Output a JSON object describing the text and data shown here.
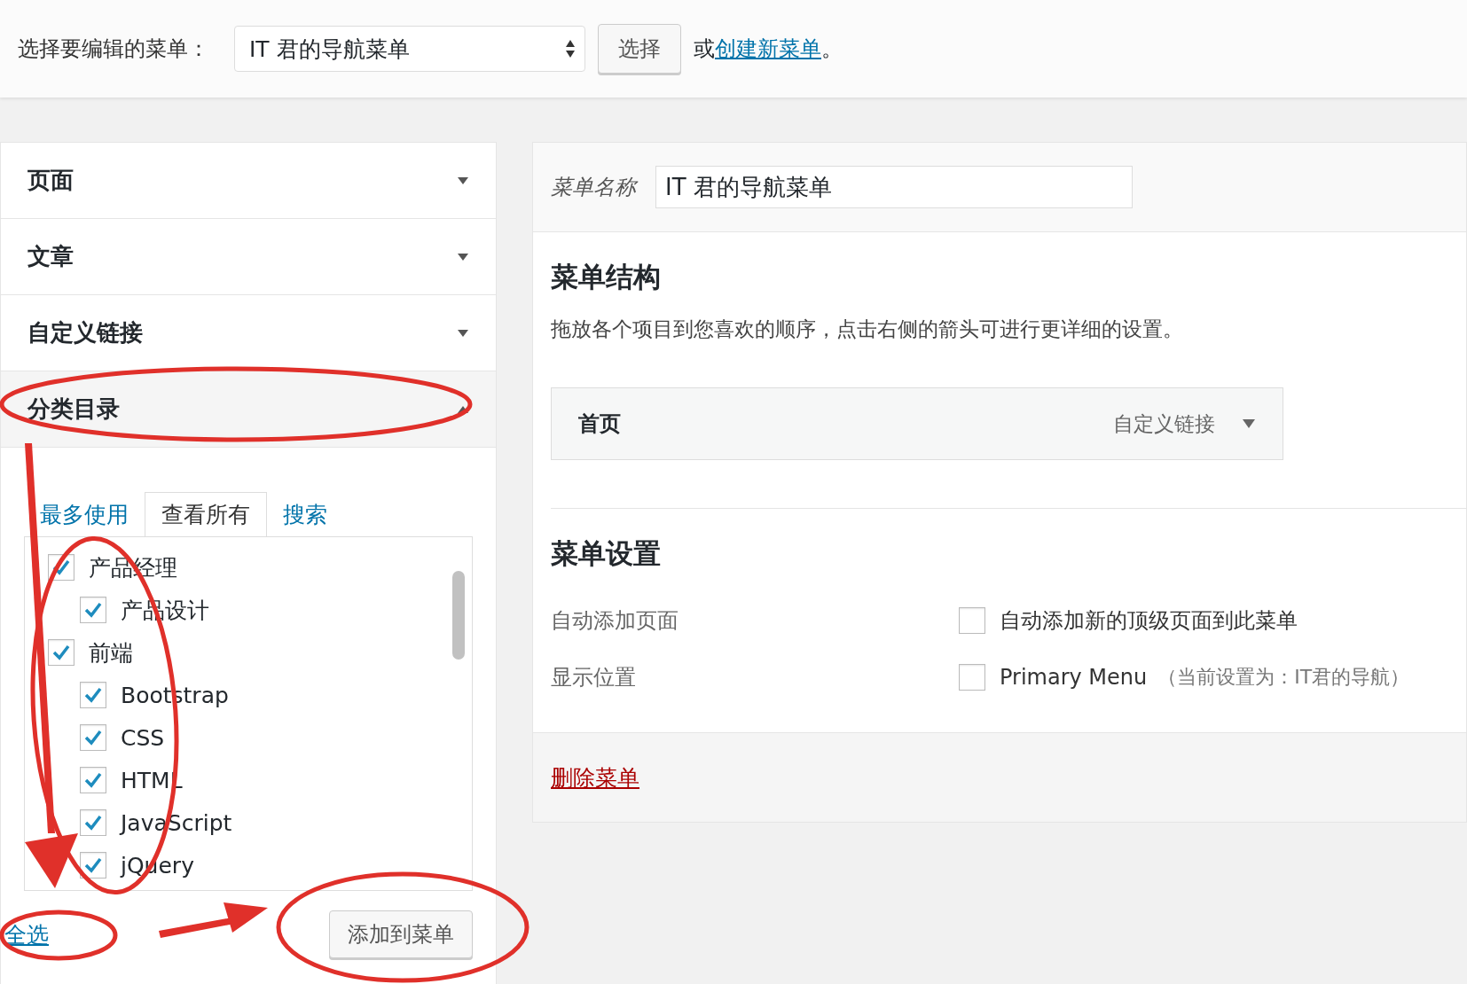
{
  "menu_select": {
    "label": "选择要编辑的菜单：",
    "value": "IT 君的导航菜单",
    "button": "选择",
    "or_text": "或",
    "create_link": "创建新菜单",
    "end_text": "。"
  },
  "sections": [
    {
      "title": "页面",
      "expanded": false
    },
    {
      "title": "文章",
      "expanded": false
    },
    {
      "title": "自定义链接",
      "expanded": false
    },
    {
      "title": "分类目录",
      "expanded": true
    }
  ],
  "category_box": {
    "tabs": [
      {
        "label": "最多使用",
        "selected": false
      },
      {
        "label": "查看所有",
        "selected": true
      },
      {
        "label": "搜索",
        "selected": false
      }
    ],
    "items": [
      {
        "label": "产品经理",
        "checked": true,
        "children": [
          {
            "label": "产品设计",
            "checked": true
          }
        ]
      },
      {
        "label": "前端",
        "checked": true,
        "children": [
          {
            "label": "Bootstrap",
            "checked": true
          },
          {
            "label": "CSS",
            "checked": true
          },
          {
            "label": "HTML",
            "checked": true
          },
          {
            "label": "JavaScript",
            "checked": true
          },
          {
            "label": "jQuery",
            "checked": true
          }
        ]
      }
    ],
    "select_all": "全选",
    "add_button": "添加到菜单"
  },
  "menu_editor": {
    "name_label": "菜单名称",
    "name_value": "IT 君的导航菜单",
    "structure_title": "菜单结构",
    "structure_hint": "拖放各个项目到您喜欢的顺序，点击右侧的箭头可进行更详细的设置。",
    "items": [
      {
        "title": "首页",
        "type": "自定义链接"
      }
    ],
    "settings_title": "菜单设置",
    "settings": [
      {
        "label": "自动添加页面",
        "option": "自动添加新的顶级页面到此菜单",
        "checked": false
      },
      {
        "label": "显示位置",
        "option": "Primary Menu",
        "note": "（当前设置为：IT君的导航）",
        "checked": false
      }
    ],
    "delete_link": "删除菜单"
  }
}
